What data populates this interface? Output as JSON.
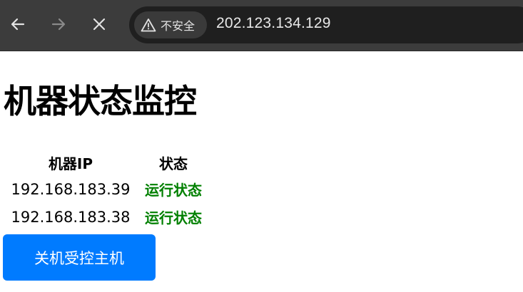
{
  "browser": {
    "security_label": "不安全",
    "url": "202.123.134.129"
  },
  "page": {
    "title": "机器状态监控",
    "table": {
      "headers": [
        "机器IP",
        "状态"
      ],
      "rows": [
        {
          "ip": "192.168.183.39",
          "status": "运行状态"
        },
        {
          "ip": "192.168.183.38",
          "status": "运行状态"
        }
      ]
    },
    "shutdown_button_label": "关机受控主机"
  },
  "colors": {
    "status_ok": "#008000",
    "button": "#007bff"
  }
}
